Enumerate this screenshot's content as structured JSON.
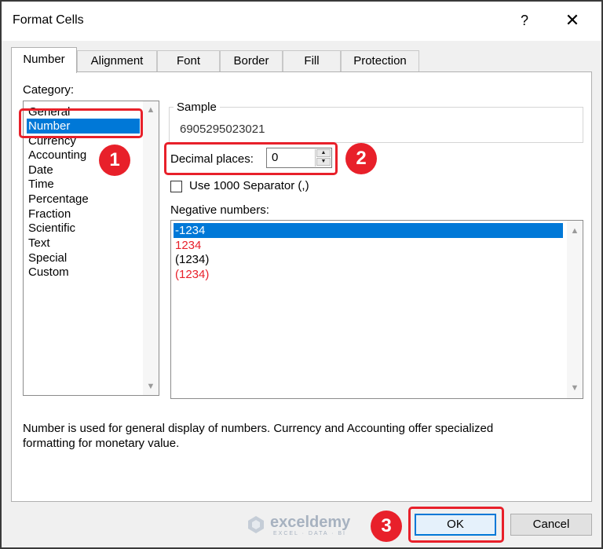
{
  "window": {
    "title": "Format Cells",
    "help_glyph": "?",
    "close_glyph": "✕"
  },
  "tabs": [
    {
      "label": "Number"
    },
    {
      "label": "Alignment"
    },
    {
      "label": "Font"
    },
    {
      "label": "Border"
    },
    {
      "label": "Fill"
    },
    {
      "label": "Protection"
    }
  ],
  "category": {
    "label": "Category:",
    "items": [
      "General",
      "Number",
      "Currency",
      "Accounting",
      "Date",
      "Time",
      "Percentage",
      "Fraction",
      "Scientific",
      "Text",
      "Special",
      "Custom"
    ],
    "selected": "Number"
  },
  "sample": {
    "label": "Sample",
    "value": "6905295023021"
  },
  "decimal": {
    "label": "Decimal places:",
    "value": "0"
  },
  "separator": {
    "label": "Use 1000 Separator (,)",
    "checked": false
  },
  "negative": {
    "label": "Negative numbers:",
    "items": [
      {
        "text": "-1234",
        "color": "#ffffff"
      },
      {
        "text": "1234",
        "color": "#e8202a"
      },
      {
        "text": "(1234)",
        "color": "#000000"
      },
      {
        "text": "(1234)",
        "color": "#e8202a"
      }
    ]
  },
  "description": {
    "line1": "Number is used for general display of numbers.  Currency and Accounting offer specialized",
    "line2": "formatting for monetary value."
  },
  "buttons": {
    "ok": "OK",
    "cancel": "Cancel"
  },
  "watermark": {
    "name": "exceldemy",
    "tagline": "EXCEL · DATA · BI"
  },
  "annotations": {
    "badge1": "1",
    "badge2": "2",
    "badge3": "3",
    "color": "#e8202a"
  },
  "colors": {
    "selection": "#0078d7",
    "accent_red": "#e8202a"
  }
}
